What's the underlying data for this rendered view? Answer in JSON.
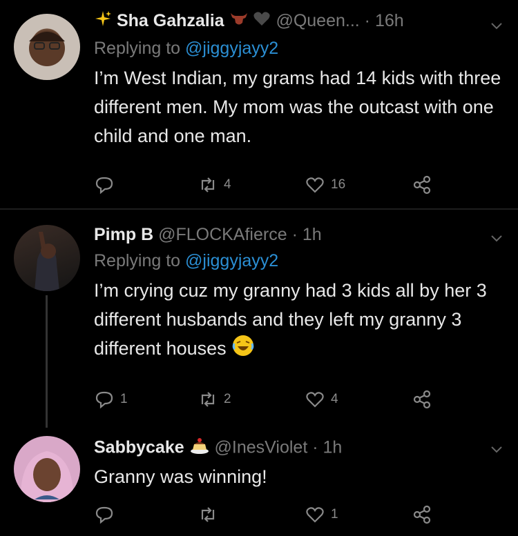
{
  "tweets": [
    {
      "name": "Sha Gahzalia",
      "handle": "@Queen...",
      "time": "16h",
      "replying_prefix": "Replying to",
      "replying_to": "@jiggyjayy2",
      "text": "I’m West Indian, my grams had 14 kids with three different men. My mom was the outcast with one child and one man.",
      "replies": "",
      "retweets": "4",
      "likes": "16"
    },
    {
      "name": "Pimp B",
      "handle": "@FLOCKAfierce",
      "time": "1h",
      "replying_prefix": "Replying to",
      "replying_to": "@jiggyjayy2",
      "text": "I’m crying cuz my granny had 3 kids all by her 3 different husbands and they left my granny 3 different houses",
      "replies": "1",
      "retweets": "2",
      "likes": "4"
    },
    {
      "name": "Sabbycake",
      "handle": "@InesViolet",
      "time": "1h",
      "text": "Granny was winning!",
      "replies": "",
      "retweets": "",
      "likes": "1"
    }
  ],
  "separator": "·",
  "icons": [
    "sparkles-icon",
    "bull-icon",
    "heart-icon",
    "laughing-emoji-icon",
    "cake-icon",
    "reply-icon",
    "retweet-icon",
    "like-icon",
    "share-icon",
    "chevron-down-icon"
  ],
  "colors": {
    "background": "#000000",
    "mention": "#2b8fd4",
    "muted": "#7a7a7a",
    "text": "#e8e8e8"
  }
}
